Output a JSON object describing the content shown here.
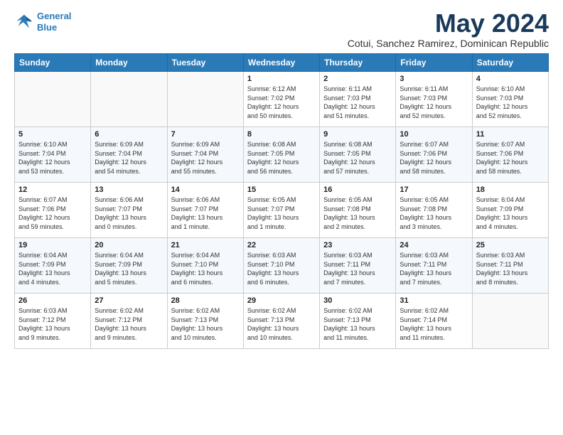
{
  "header": {
    "logo_line1": "General",
    "logo_line2": "Blue",
    "month_year": "May 2024",
    "subtitle": "Cotui, Sanchez Ramirez, Dominican Republic"
  },
  "days_of_week": [
    "Sunday",
    "Monday",
    "Tuesday",
    "Wednesday",
    "Thursday",
    "Friday",
    "Saturday"
  ],
  "weeks": [
    [
      {
        "day": "",
        "info": ""
      },
      {
        "day": "",
        "info": ""
      },
      {
        "day": "",
        "info": ""
      },
      {
        "day": "1",
        "info": "Sunrise: 6:12 AM\nSunset: 7:02 PM\nDaylight: 12 hours\nand 50 minutes."
      },
      {
        "day": "2",
        "info": "Sunrise: 6:11 AM\nSunset: 7:03 PM\nDaylight: 12 hours\nand 51 minutes."
      },
      {
        "day": "3",
        "info": "Sunrise: 6:11 AM\nSunset: 7:03 PM\nDaylight: 12 hours\nand 52 minutes."
      },
      {
        "day": "4",
        "info": "Sunrise: 6:10 AM\nSunset: 7:03 PM\nDaylight: 12 hours\nand 52 minutes."
      }
    ],
    [
      {
        "day": "5",
        "info": "Sunrise: 6:10 AM\nSunset: 7:04 PM\nDaylight: 12 hours\nand 53 minutes."
      },
      {
        "day": "6",
        "info": "Sunrise: 6:09 AM\nSunset: 7:04 PM\nDaylight: 12 hours\nand 54 minutes."
      },
      {
        "day": "7",
        "info": "Sunrise: 6:09 AM\nSunset: 7:04 PM\nDaylight: 12 hours\nand 55 minutes."
      },
      {
        "day": "8",
        "info": "Sunrise: 6:08 AM\nSunset: 7:05 PM\nDaylight: 12 hours\nand 56 minutes."
      },
      {
        "day": "9",
        "info": "Sunrise: 6:08 AM\nSunset: 7:05 PM\nDaylight: 12 hours\nand 57 minutes."
      },
      {
        "day": "10",
        "info": "Sunrise: 6:07 AM\nSunset: 7:06 PM\nDaylight: 12 hours\nand 58 minutes."
      },
      {
        "day": "11",
        "info": "Sunrise: 6:07 AM\nSunset: 7:06 PM\nDaylight: 12 hours\nand 58 minutes."
      }
    ],
    [
      {
        "day": "12",
        "info": "Sunrise: 6:07 AM\nSunset: 7:06 PM\nDaylight: 12 hours\nand 59 minutes."
      },
      {
        "day": "13",
        "info": "Sunrise: 6:06 AM\nSunset: 7:07 PM\nDaylight: 13 hours\nand 0 minutes."
      },
      {
        "day": "14",
        "info": "Sunrise: 6:06 AM\nSunset: 7:07 PM\nDaylight: 13 hours\nand 1 minute."
      },
      {
        "day": "15",
        "info": "Sunrise: 6:05 AM\nSunset: 7:07 PM\nDaylight: 13 hours\nand 1 minute."
      },
      {
        "day": "16",
        "info": "Sunrise: 6:05 AM\nSunset: 7:08 PM\nDaylight: 13 hours\nand 2 minutes."
      },
      {
        "day": "17",
        "info": "Sunrise: 6:05 AM\nSunset: 7:08 PM\nDaylight: 13 hours\nand 3 minutes."
      },
      {
        "day": "18",
        "info": "Sunrise: 6:04 AM\nSunset: 7:09 PM\nDaylight: 13 hours\nand 4 minutes."
      }
    ],
    [
      {
        "day": "19",
        "info": "Sunrise: 6:04 AM\nSunset: 7:09 PM\nDaylight: 13 hours\nand 4 minutes."
      },
      {
        "day": "20",
        "info": "Sunrise: 6:04 AM\nSunset: 7:09 PM\nDaylight: 13 hours\nand 5 minutes."
      },
      {
        "day": "21",
        "info": "Sunrise: 6:04 AM\nSunset: 7:10 PM\nDaylight: 13 hours\nand 6 minutes."
      },
      {
        "day": "22",
        "info": "Sunrise: 6:03 AM\nSunset: 7:10 PM\nDaylight: 13 hours\nand 6 minutes."
      },
      {
        "day": "23",
        "info": "Sunrise: 6:03 AM\nSunset: 7:11 PM\nDaylight: 13 hours\nand 7 minutes."
      },
      {
        "day": "24",
        "info": "Sunrise: 6:03 AM\nSunset: 7:11 PM\nDaylight: 13 hours\nand 7 minutes."
      },
      {
        "day": "25",
        "info": "Sunrise: 6:03 AM\nSunset: 7:11 PM\nDaylight: 13 hours\nand 8 minutes."
      }
    ],
    [
      {
        "day": "26",
        "info": "Sunrise: 6:03 AM\nSunset: 7:12 PM\nDaylight: 13 hours\nand 9 minutes."
      },
      {
        "day": "27",
        "info": "Sunrise: 6:02 AM\nSunset: 7:12 PM\nDaylight: 13 hours\nand 9 minutes."
      },
      {
        "day": "28",
        "info": "Sunrise: 6:02 AM\nSunset: 7:13 PM\nDaylight: 13 hours\nand 10 minutes."
      },
      {
        "day": "29",
        "info": "Sunrise: 6:02 AM\nSunset: 7:13 PM\nDaylight: 13 hours\nand 10 minutes."
      },
      {
        "day": "30",
        "info": "Sunrise: 6:02 AM\nSunset: 7:13 PM\nDaylight: 13 hours\nand 11 minutes."
      },
      {
        "day": "31",
        "info": "Sunrise: 6:02 AM\nSunset: 7:14 PM\nDaylight: 13 hours\nand 11 minutes."
      },
      {
        "day": "",
        "info": ""
      }
    ]
  ]
}
